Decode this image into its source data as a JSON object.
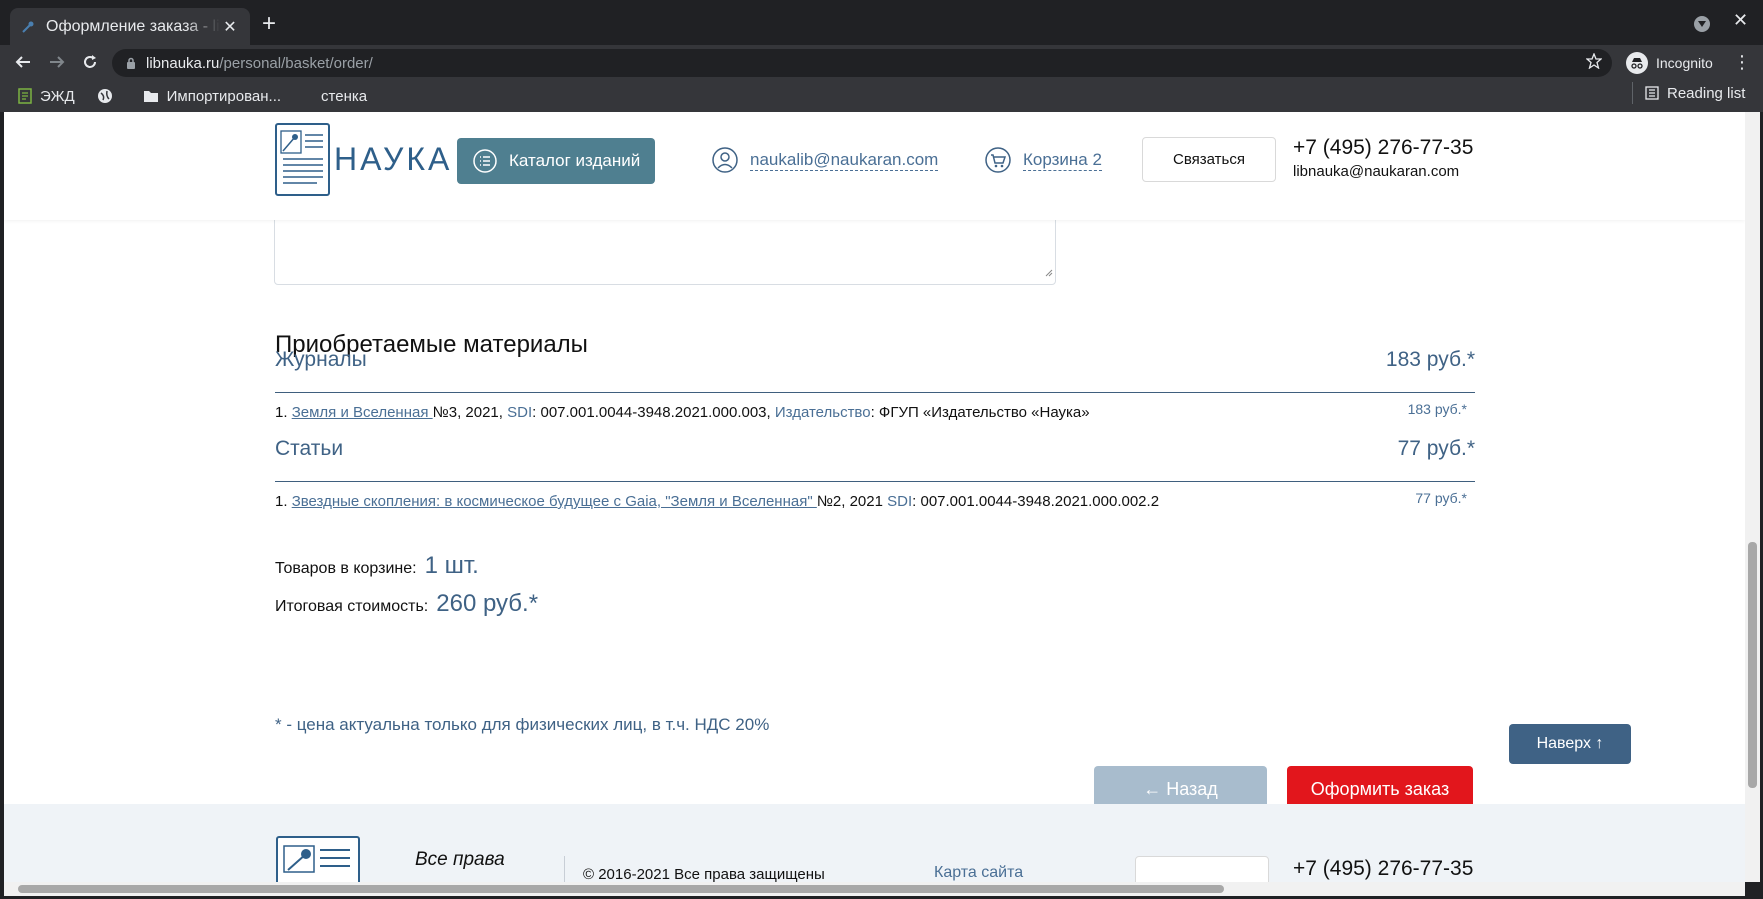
{
  "browser": {
    "tab_title": "Оформление заказа - libnauka.ru",
    "url_host": "libnauka.ru",
    "url_path": "/personal/basket/order/",
    "incognito_label": "Incognito",
    "bookmarks": [
      {
        "label": "ЭЖД"
      },
      {
        "label": ""
      },
      {
        "label": "Импортирован..."
      },
      {
        "label": "стенка"
      }
    ],
    "reading_list": "Reading list"
  },
  "header": {
    "logo_text": "НАУКА",
    "catalog_label": "Каталог изданий",
    "account_email": "naukalib@naukaran.com",
    "cart_label": "Корзина 2",
    "contact_label": "Связаться",
    "phone": "+7 (495) 276-77-35",
    "email": "libnauka@naukaran.com"
  },
  "order": {
    "section_title": "Приобретаемые материалы",
    "categories": [
      {
        "name": "Журналы",
        "price": "183 руб.*",
        "items": [
          {
            "num": "1.",
            "link": "Земля и Вселенная ",
            "issue": "№3, 2021, ",
            "sdi_label": "SDI",
            "sdi_value": ": 007.001.0044-3948.2021.000.003, ",
            "pub_label": "Издательство",
            "pub_value": ": ФГУП «Издательство «Наука»",
            "price": "183 руб.*"
          }
        ]
      },
      {
        "name": "Статьи",
        "price": "77 руб.*",
        "items": [
          {
            "num": "1.",
            "link": "Звездные скопления: в космическое будущее с Gaia, \"Земля и Вселенная\" ",
            "issue": "№2, 2021 ",
            "sdi_label": "SDI",
            "sdi_value": ": 007.001.0044-3948.2021.000.002.2",
            "price": "77 руб.*"
          }
        ]
      }
    ],
    "items_count_label": "Товаров в корзине:",
    "items_count_value": "1 шт.",
    "total_label": "Итоговая стоимость:",
    "total_value": "260 руб.*",
    "note": "* - цена актуальна только для физических лиц, в т.ч. НДС 20%",
    "back_label": "← Назад",
    "order_label": "Оформить заказ",
    "top_label": "Наверх ↑"
  },
  "footer": {
    "rights": "Все права",
    "copyright": "© 2016-2021 Все права защищены",
    "sitemap": "Карта сайта",
    "phone": "+7 (495) 276-77-35"
  }
}
